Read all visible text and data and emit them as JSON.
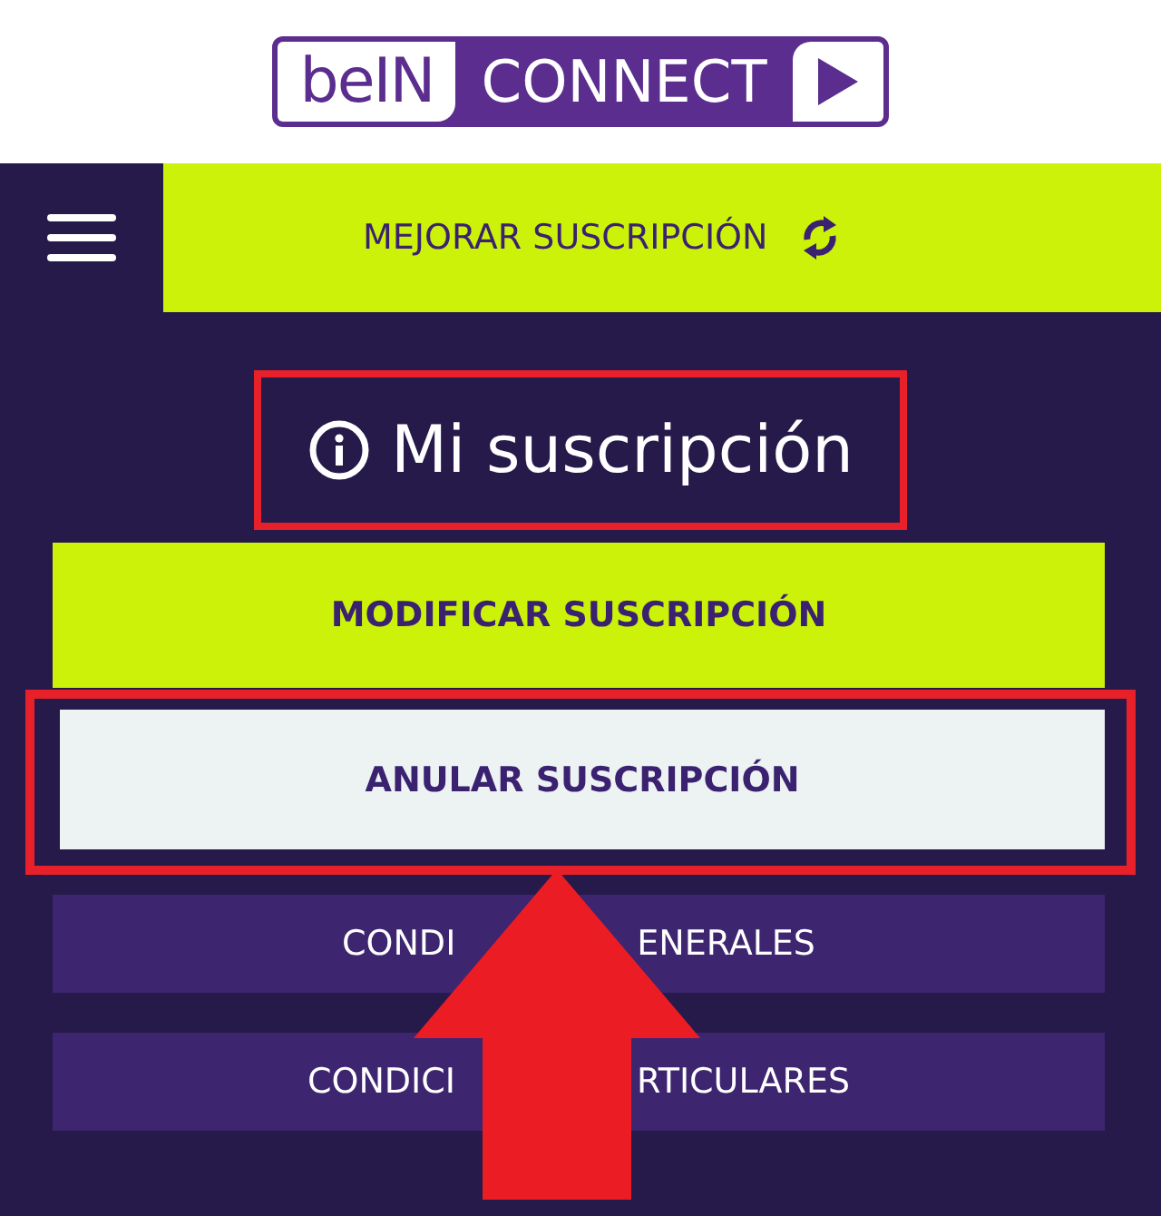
{
  "header": {
    "logo": {
      "brand": "beIN",
      "product": "CONNECT"
    }
  },
  "nav": {
    "upgrade_label": "MEJORAR SUSCRIPCIÓN"
  },
  "title": {
    "text": "Mi suscripción",
    "highlighted": true
  },
  "buttons": [
    {
      "kind": "primary",
      "parts": [
        "MODIFICAR SUSCRIPCIÓN"
      ],
      "highlighted": false
    },
    {
      "kind": "light",
      "parts": [
        "ANULAR SUSCRIPCIÓN"
      ],
      "highlighted": true
    },
    {
      "kind": "dark",
      "parts": [
        "CONDI",
        "ENERALES"
      ],
      "highlighted": false
    },
    {
      "kind": "dark",
      "parts": [
        "CONDICI",
        "RTICULARES"
      ],
      "highlighted": false
    }
  ]
}
